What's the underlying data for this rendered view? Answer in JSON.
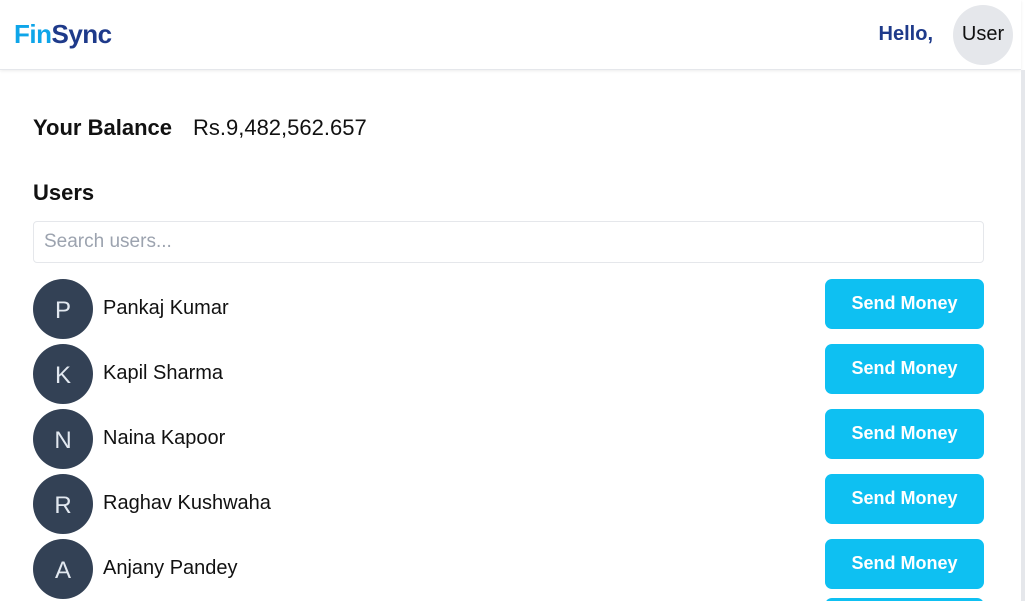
{
  "app": {
    "logo_fin": "Fin",
    "logo_sync": "Sync"
  },
  "header": {
    "greeting": "Hello,",
    "user_label": "User"
  },
  "balance": {
    "label": "Your Balance",
    "value": "Rs.9,482,562.657"
  },
  "users_section": {
    "heading": "Users",
    "search_placeholder": "Search users..."
  },
  "users": [
    {
      "initial": "P",
      "name": "Pankaj Kumar",
      "action": "Send Money"
    },
    {
      "initial": "K",
      "name": "Kapil Sharma",
      "action": "Send Money"
    },
    {
      "initial": "N",
      "name": "Naina Kapoor",
      "action": "Send Money"
    },
    {
      "initial": "R",
      "name": "Raghav Kushwaha",
      "action": "Send Money"
    },
    {
      "initial": "A",
      "name": "Anjany Pandey",
      "action": "Send Money"
    }
  ],
  "colors": {
    "accent": "#0ec0f2",
    "brand_dark": "#1e3a8a",
    "brand_light": "#0ea5e9",
    "avatar_bg": "#334155"
  }
}
